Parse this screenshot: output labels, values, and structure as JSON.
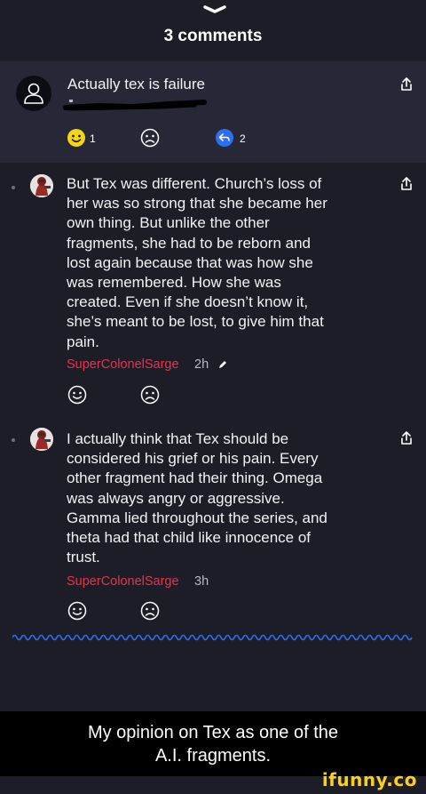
{
  "header": {
    "title": "3 comments"
  },
  "comments": [
    {
      "text_lines": [
        "Actually tex is failure"
      ],
      "reactions": {
        "like_count": "1",
        "reply_count": "2"
      }
    },
    {
      "text_lines": [
        "But Tex was different. Church’s loss of",
        "her was so strong that she became her",
        "own thing. But unlike the other",
        "fragments, she had to be reborn and",
        "lost again because that was how she",
        "was remembered. How she was",
        "created. Even if she doesn’t know it,",
        "she’s meant to be lost, to give him that",
        "pain."
      ],
      "username": "SuperColonelSarge",
      "time": "2h"
    },
    {
      "text_lines": [
        "I actually think that Tex should be",
        "considered his grief or his pain. Every",
        "other fragment had their thing. Omega",
        "was always angry or aggressive.",
        "Gamma lied throughout the series, and",
        "theta had that child like innocence of",
        "trust."
      ],
      "username": "SuperColonelSarge",
      "time": "3h"
    }
  ],
  "caption": {
    "line1": "My opinion on Tex as one of the",
    "line2": "A.I. fragments."
  },
  "watermark": "ifunny.co",
  "colors": {
    "background": "#1c1d27",
    "highlight": "#262837",
    "username": "#e8334d",
    "accent_blue": "#2d6ff0",
    "emoji_yellow": "#f5d614",
    "wave": "#2d6ff0",
    "watermark": "#fdcf1a"
  },
  "icons": [
    "chevron-down-icon",
    "user-icon",
    "share-icon",
    "smile-icon",
    "sad-icon",
    "reply-icon",
    "edit-pencil-icon"
  ]
}
